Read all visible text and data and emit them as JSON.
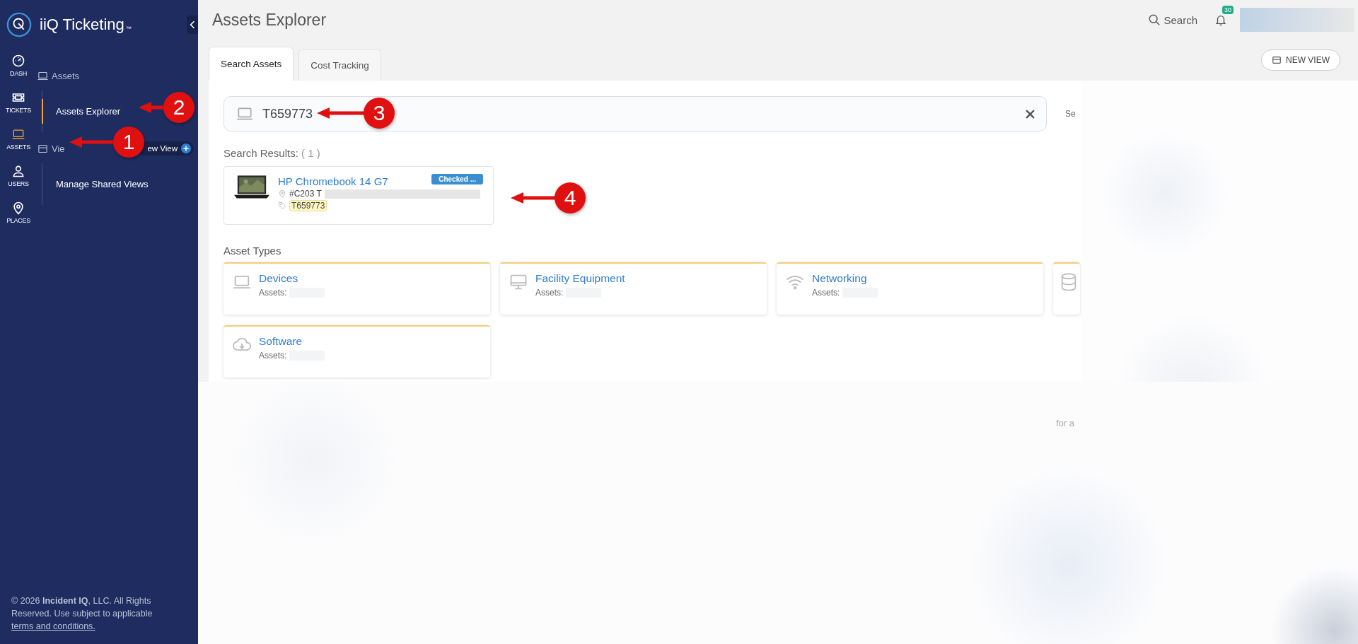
{
  "sidebar": {
    "brand": "iiQ Ticketing",
    "brand_mark": "™",
    "rail": [
      {
        "label": "DASH",
        "kind": "gauge",
        "selected": false
      },
      {
        "label": "TICKETS",
        "kind": "ticket",
        "selected": false
      },
      {
        "label": "ASSETS",
        "kind": "laptop",
        "selected": true
      },
      {
        "label": "USERS",
        "kind": "user",
        "selected": false
      },
      {
        "label": "PLACES",
        "kind": "pin",
        "selected": false
      }
    ],
    "groups": [
      {
        "header": {
          "label": "Assets",
          "kind": "laptop"
        },
        "items": [
          {
            "label": "Assets Explorer",
            "selected": true
          }
        ]
      },
      {
        "header": {
          "label": "Vie",
          "kind": "panel",
          "action": "ew View"
        },
        "items": [
          {
            "label": "Manage Shared Views",
            "selected": false
          }
        ]
      }
    ],
    "footer": {
      "text": "© 2026 **Incident IQ**, LLC. All Rights Reserved. Use subject to applicable",
      "link": "terms and conditions."
    }
  },
  "header": {
    "title": "Assets Explorer",
    "search_label": "Search",
    "notification_count": "30"
  },
  "tabs": [
    {
      "label": "Search Assets",
      "selected": true
    },
    {
      "label": "Cost Tracking",
      "selected": false
    }
  ],
  "new_view_button": "NEW VIEW",
  "search": {
    "value": "T659773",
    "side_text": "Se"
  },
  "results": {
    "label": "Search Results:",
    "count": "( 1 )",
    "items": [
      {
        "title": "HP Chromebook 14 G7",
        "status": "Checked ...",
        "location": "#C203 T",
        "tag": "T659773"
      }
    ]
  },
  "asset_types": {
    "label": "Asset Types",
    "items": [
      {
        "kind": "laptop",
        "title": "Devices",
        "count_label": "Assets:"
      },
      {
        "kind": "monitor",
        "title": "Facility Equipment",
        "count_label": "Assets:"
      },
      {
        "kind": "wifi",
        "title": "Networking",
        "count_label": "Assets:"
      },
      {
        "kind": "database"
      },
      {
        "kind": "cloud",
        "title": "Software",
        "count_label": "Assets:"
      }
    ]
  },
  "blurred_text": "for a",
  "callouts": [
    {
      "number": "1"
    },
    {
      "number": "2"
    },
    {
      "number": "3"
    },
    {
      "number": "4"
    }
  ]
}
